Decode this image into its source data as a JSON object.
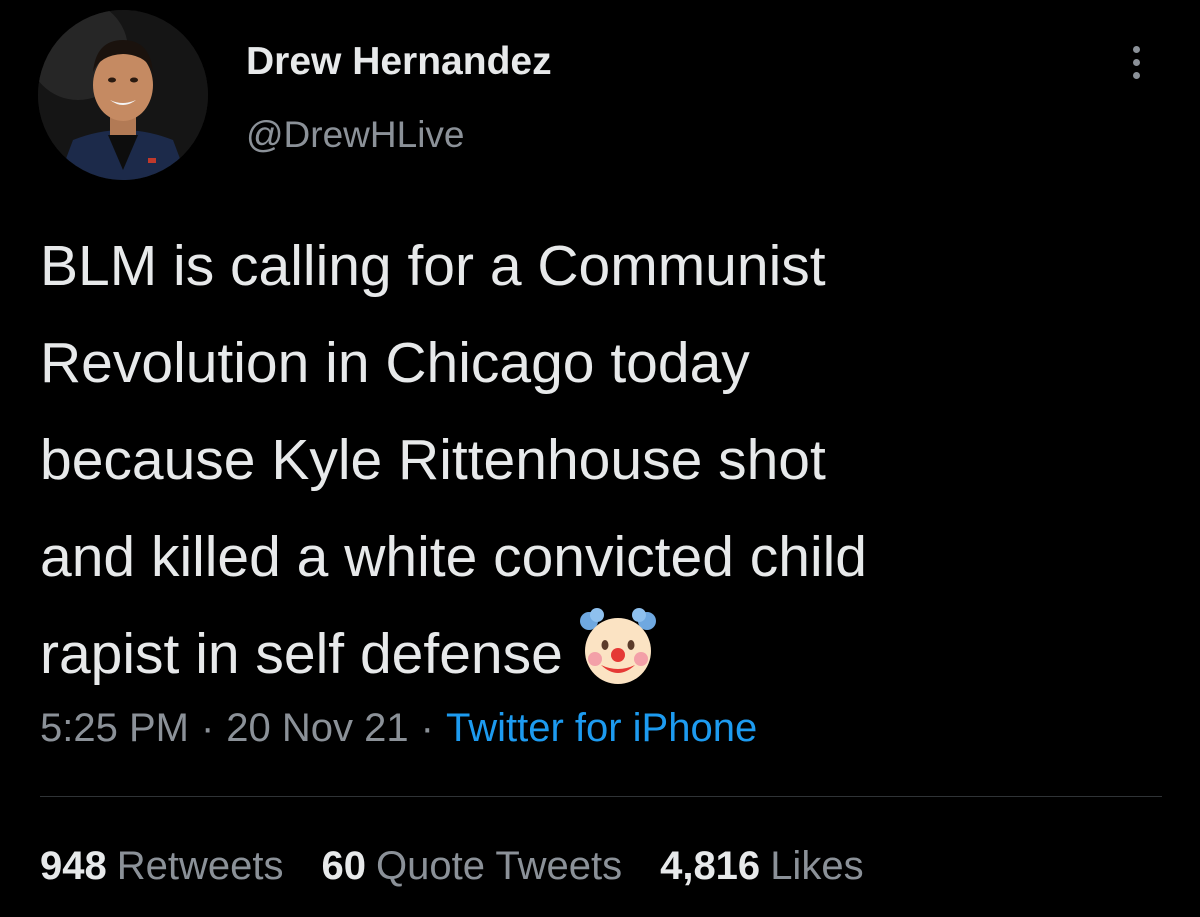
{
  "user": {
    "display_name": "Drew Hernandez",
    "handle": "@DrewHLive"
  },
  "tweet": {
    "text_lines": [
      "BLM is calling for a Communist",
      "Revolution in Chicago today",
      "because Kyle Rittenhouse shot",
      "and killed a white convicted child",
      "rapist in self defense"
    ],
    "emoji": "clown-face",
    "time": "5:25 PM",
    "separator": "·",
    "date": "20 Nov 21",
    "source": "Twitter for iPhone"
  },
  "stats": {
    "retweets_count": "948",
    "retweets_label": "Retweets",
    "quotes_count": "60",
    "quotes_label": "Quote Tweets",
    "likes_count": "4,816",
    "likes_label": "Likes"
  },
  "colors": {
    "background": "#000000",
    "text": "#e7e9ea",
    "secondary": "#8b9198",
    "link": "#1d9bf0",
    "divider": "#2f3336"
  },
  "icons": {
    "more": "more-vertical-icon",
    "emoji": "clown-face-icon"
  }
}
